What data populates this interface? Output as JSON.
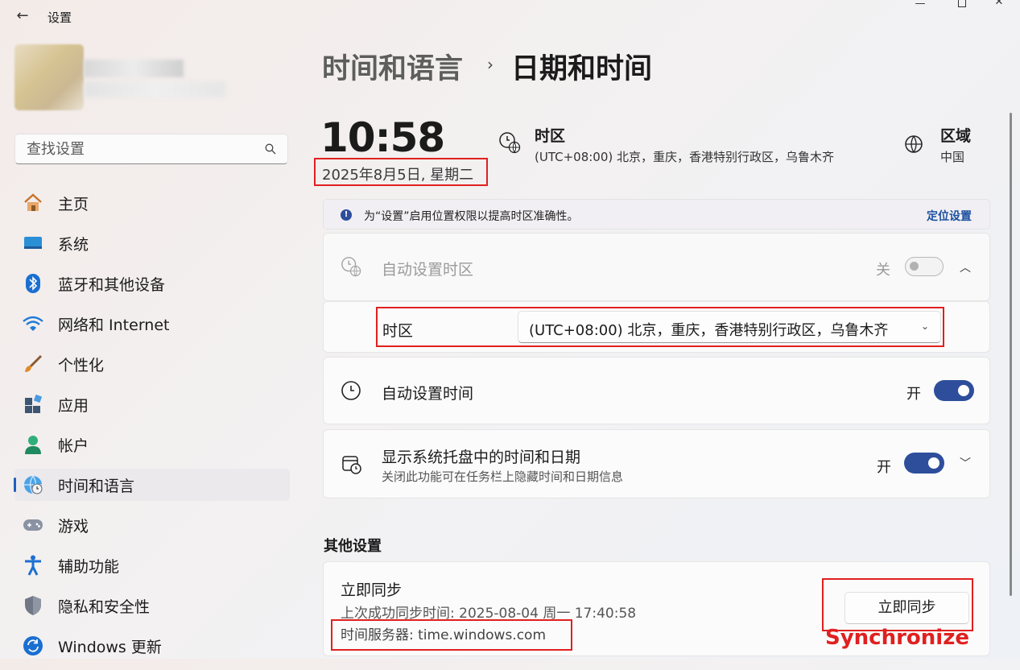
{
  "window": {
    "title": "设置",
    "back_icon": "arrow-left-icon"
  },
  "profile": {
    "avatar": "blurred-user-avatar"
  },
  "search": {
    "placeholder": "查找设置",
    "icon": "search-icon"
  },
  "sidebar": {
    "items": [
      {
        "label": "主页",
        "icon": "home-icon"
      },
      {
        "label": "系统",
        "icon": "display-icon"
      },
      {
        "label": "蓝牙和其他设备",
        "icon": "bluetooth-icon"
      },
      {
        "label": "网络和 Internet",
        "icon": "wifi-icon"
      },
      {
        "label": "个性化",
        "icon": "brush-icon"
      },
      {
        "label": "应用",
        "icon": "apps-icon"
      },
      {
        "label": "帐户",
        "icon": "person-icon"
      },
      {
        "label": "时间和语言",
        "icon": "time-language-icon",
        "active": true
      },
      {
        "label": "游戏",
        "icon": "gamepad-icon"
      },
      {
        "label": "辅助功能",
        "icon": "accessibility-icon"
      },
      {
        "label": "隐私和安全性",
        "icon": "shield-icon"
      },
      {
        "label": "Windows 更新",
        "icon": "update-icon"
      }
    ]
  },
  "breadcrumb": {
    "parent": "时间和语言",
    "separator": "›",
    "current": "日期和时间"
  },
  "summary": {
    "time": "10:58",
    "date": "2025年8月5日, 星期二",
    "timezone_title": "时区",
    "timezone_value": "(UTC+08:00) 北京，重庆，香港特别行政区，乌鲁木齐",
    "region_title": "区域",
    "region_value": "中国"
  },
  "banner": {
    "text": "为“设置”启用位置权限以提高时区准确性。",
    "link": "定位设置"
  },
  "auto_timezone": {
    "label": "自动设置时区",
    "state": "关",
    "on": false
  },
  "timezone_row": {
    "label": "时区",
    "value": "(UTC+08:00) 北京，重庆，香港特别行政区，乌鲁木齐"
  },
  "auto_time": {
    "label": "自动设置时间",
    "state": "开",
    "on": true
  },
  "tray": {
    "label": "显示系统托盘中的时间和日期",
    "description": "关闭此功能可在任务栏上隐藏时间和日期信息",
    "state": "开",
    "on": true
  },
  "other": {
    "heading": "其他设置",
    "sync_title": "立即同步",
    "last_sync": "上次成功同步时间: 2025-08-04 周一 17:40:58",
    "server": "时间服务器: time.windows.com",
    "sync_button": "立即同步"
  },
  "annotation": {
    "text": "Synchronize"
  },
  "colors": {
    "accent": "#2e4e9c",
    "highlight_box": "#e0201f"
  }
}
